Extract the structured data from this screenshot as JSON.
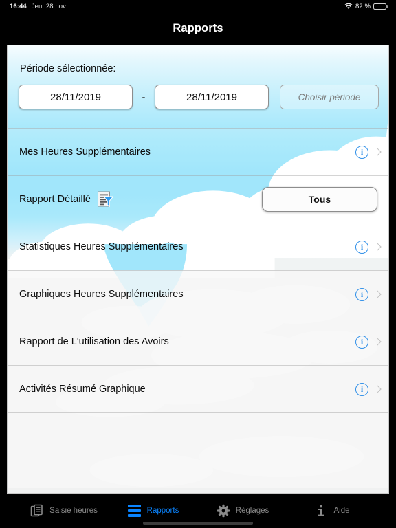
{
  "status_bar": {
    "time": "16:44",
    "date": "Jeu. 28 nov.",
    "wifi_icon": "wifi-icon",
    "battery_percent": "82 %",
    "battery_icon": "battery-icon",
    "battery_level": 82
  },
  "nav": {
    "title": "Rapports"
  },
  "period": {
    "label": "Période sélectionnée:",
    "start_date": "28/11/2019",
    "separator": "-",
    "end_date": "28/11/2019",
    "choose_button": "Choisir période"
  },
  "rows": [
    {
      "label": "Mes Heures Supplémentaires",
      "has_info": true,
      "has_chevron": true,
      "icon": null,
      "button": null
    },
    {
      "label": "Rapport Détaillé",
      "has_info": false,
      "has_chevron": false,
      "icon": "document-filter-icon",
      "button": "Tous"
    },
    {
      "label": "Statistiques Heures Supplémentaires",
      "has_info": true,
      "has_chevron": true,
      "icon": null,
      "button": null
    },
    {
      "label": "Graphiques Heures Supplémentaires",
      "has_info": true,
      "has_chevron": true,
      "icon": null,
      "button": null
    },
    {
      "label": "Rapport de L'utilisation des Avoirs",
      "has_info": true,
      "has_chevron": true,
      "icon": null,
      "button": null
    },
    {
      "label": "Activités Résumé Graphique",
      "has_info": true,
      "has_chevron": true,
      "icon": null,
      "button": null
    }
  ],
  "info_glyph": "i",
  "tabs": [
    {
      "label": "Saisie heures",
      "icon": "documents-icon",
      "active": false
    },
    {
      "label": "Rapports",
      "icon": "report-bars-icon",
      "active": true
    },
    {
      "label": "Réglages",
      "icon": "gear-icon",
      "active": false
    },
    {
      "label": "Aide",
      "icon": "info-i-icon",
      "active": false
    }
  ],
  "colors": {
    "accent_blue": "#0a84ff",
    "info_blue": "#2f8fe8",
    "sky_blue": "#8fe2fb",
    "tab_inactive": "#8a8a8a",
    "card_bg": "#eef0f0"
  }
}
